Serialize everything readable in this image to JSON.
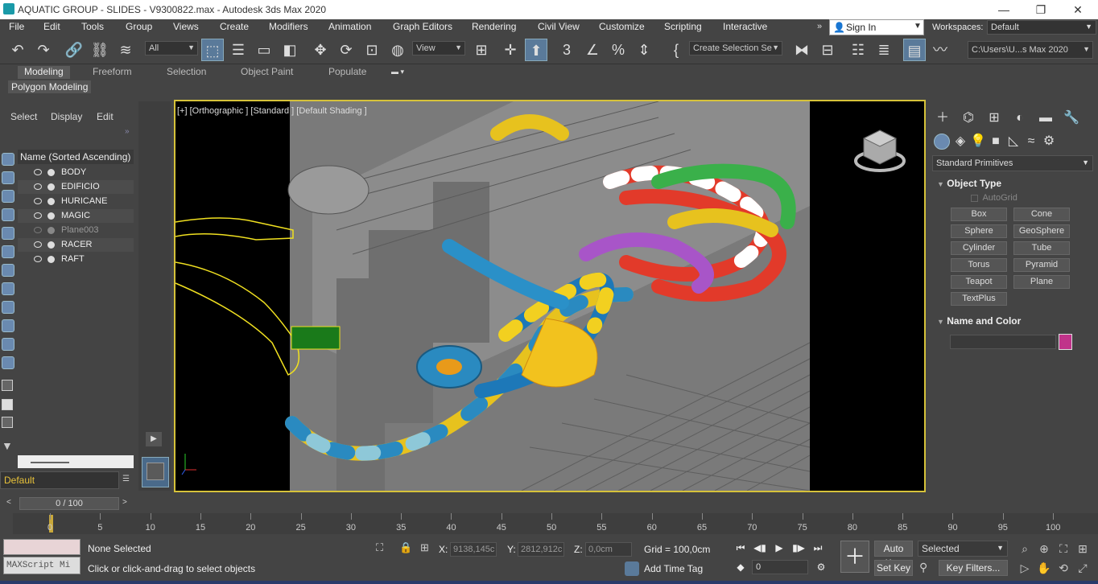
{
  "window": {
    "title": "AQUATIC GROUP - SLIDES - V9300822.max - Autodesk 3ds Max 2020",
    "minimize": "—",
    "maximize": "❐",
    "close": "✕"
  },
  "menu": [
    "File",
    "Edit",
    "Tools",
    "Group",
    "Views",
    "Create",
    "Modifiers",
    "Animation",
    "Graph Editors",
    "Rendering",
    "Civil View",
    "Customize",
    "Scripting",
    "Interactive"
  ],
  "account": {
    "sign_in": "Sign In",
    "workspaces_label": "Workspaces:",
    "workspace": "Default"
  },
  "toolbar": {
    "filter": "All",
    "ref_coord": "View",
    "named_selection": "Create Selection Se",
    "path": "C:\\Users\\U...s Max 2020"
  },
  "ribbon": {
    "tabs": [
      "Modeling",
      "Freeform",
      "Selection",
      "Object Paint",
      "Populate"
    ],
    "active": "Modeling",
    "sub": "Polygon Modeling"
  },
  "scene_explorer": {
    "tabs": [
      "Select",
      "Display",
      "Edit"
    ],
    "header": "Name (Sorted Ascending)",
    "items": [
      "BODY",
      "EDIFICIO",
      "HURICANE",
      "MAGIC",
      "Plane003",
      "RACER",
      "RAFT"
    ],
    "layer": "Default"
  },
  "viewport": {
    "label": "[+] [Orthographic ] [Standard ] [Default Shading ]"
  },
  "command_panel": {
    "category": "Standard Primitives",
    "object_type_title": "Object Type",
    "autogrid": "AutoGrid",
    "buttons": [
      "Box",
      "Cone",
      "Sphere",
      "GeoSphere",
      "Cylinder",
      "Tube",
      "Torus",
      "Pyramid",
      "Teapot",
      "Plane",
      "TextPlus"
    ],
    "name_color_title": "Name and Color",
    "object_color": "#c0338a"
  },
  "timeline": {
    "slider": "0 / 100",
    "ticks": [
      "0",
      "5",
      "10",
      "15",
      "20",
      "25",
      "30",
      "35",
      "40",
      "45",
      "50",
      "55",
      "60",
      "65",
      "70",
      "75",
      "80",
      "85",
      "90",
      "95",
      "100"
    ]
  },
  "status": {
    "maxscript": "MAXScript Mi",
    "selection": "None Selected",
    "prompt": "Click or click-and-drag to select objects",
    "x_label": "X:",
    "x": "9138,145c",
    "y_label": "Y:",
    "y": "2812,912c",
    "z_label": "Z:",
    "z": "0,0cm",
    "grid": "Grid = 100,0cm",
    "add_time_tag": "Add Time Tag",
    "auto_key": "Auto Key",
    "set_key": "Set Key",
    "key_mode": "Selected",
    "key_filters": "Key Filters...",
    "frame": "0"
  }
}
